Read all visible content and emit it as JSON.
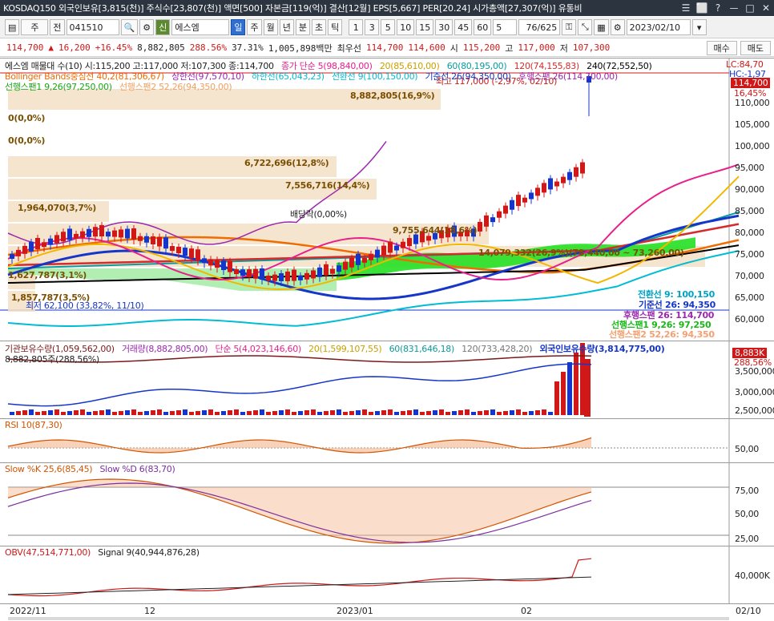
{
  "window": {
    "title": "KOSDAQ150 외국인보유[3,815(천)] 주식수[23,807(천)] 액면[500] 자본금[119(억)] 결산[12월] EPS[5,667] PER[20.24] 시가총액[27,307(억)] 유통비",
    "buttons": [
      "☰",
      "⬜",
      "?",
      "ㅡ",
      "□",
      "✕"
    ]
  },
  "toolbar": {
    "menu_icon": "▤",
    "market": "주",
    "all_label": "전",
    "code": "041510",
    "search_icon": "🔍",
    "new_badge": "신",
    "stock_name": "에스엠",
    "periods": [
      "일",
      "주",
      "월",
      "년",
      "분",
      "초",
      "틱"
    ],
    "intervals": [
      "1",
      "3",
      "5",
      "10",
      "15",
      "30",
      "45",
      "60",
      "5"
    ],
    "page_counter": "76/625",
    "date": "2023/02/10"
  },
  "quote": {
    "price": "114,700",
    "arrow": "▲",
    "change": "16,200",
    "change_pct": "+16.45%",
    "volume": "8,882,805",
    "volume_ratio": "288.56%",
    "turnover": "37.31%",
    "amount": "1,005,898백만",
    "best_label": "최우선",
    "best_price": "114,700",
    "ask": "114,600",
    "open_label": "시",
    "open": "115,200",
    "high_label": "고",
    "high": "117,000",
    "low_label": "저",
    "low": "107,300",
    "buy_label": "매수",
    "sell_label": "매도"
  },
  "price_panel": {
    "legend1": "에스엠 매물대 수(10)  시:115,200 고:117,000 저:107,300 종:114,700",
    "legend1_ma": [
      "종가 단순 5(98,840,00)",
      "20(85,610,00)",
      "60(80,195,00)",
      "120(74,155,83)",
      "240(72,552,50)"
    ],
    "legend2": [
      "Bollinger Bands중심선 40,2(81,306,67)",
      "상한선(97,570,10)",
      "하한선(65,043,23)",
      "전환선 9(100,150,00)",
      "기준선 26(94,350,00)",
      "후행스팬 26(114,700,00)"
    ],
    "legend3": [
      "선행스팬1 9,26(97,250,00)",
      "선행스팬2 52,26(94,350,00)"
    ],
    "right_lc": "LC:84,70",
    "right_hc": "HC:-1,97",
    "price_box": "114,700",
    "price_pct": "16,45%",
    "y_labels": [
      "110,000",
      "105,000",
      "100,000",
      "95,000",
      "90,000",
      "85,000",
      "80,000",
      "75,000",
      "70,000",
      "65,000",
      "60,000"
    ],
    "volume_profile_labels": [
      "8,882,805(16,9%)",
      "0(0,0%)",
      "0(0,0%)",
      "6,722,696(12,8%)",
      "7,556,716(14,4%)",
      "1,964,070(3,7%)",
      "9,755,644(18,6%)",
      "14,079,332(26,9%)(78,440,00 ~ 73,260,00)",
      "1,627,787(3,1%)",
      "1,857,787(3,5%)"
    ],
    "high_note": "최고 117,000 (-2,97%, 02/10)",
    "low_note": "최저 62,100 (33,82%, 11/10)",
    "dividend_note": "배당락(0,00%)",
    "right_values": [
      "전환선 9: 100,150",
      "기준선 26: 94,350",
      "후행스팬 26: 114,700",
      "선행스팬1 9,26: 97,250",
      "선행스팬2 52,26: 94,350"
    ]
  },
  "volume_panel": {
    "legend": [
      "기관보유수량(1,059,562,00)",
      "거래량(8,882,805,00)",
      "단순 5(4,023,146,60)",
      "20(1,599,107,55)",
      "60(831,646,18)",
      "120(733,428,20)",
      "외국인보유수량(3,814,775,00)"
    ],
    "legend2": "8,882,805주(288,56%)",
    "right_box": "8,883K",
    "right_pct": "288,56%",
    "y_labels": [
      "3,500,000",
      "3,000,000",
      "2,500,000"
    ]
  },
  "rsi_panel": {
    "legend": "RSI 10(87,30)",
    "y_labels": [
      "50,00"
    ]
  },
  "stoch_panel": {
    "legend": [
      "Slow %K 25,6(85,45)",
      "Slow %D 6(83,70)"
    ],
    "y_labels": [
      "75,00",
      "50,00",
      "25,00"
    ]
  },
  "obv_panel": {
    "legend": [
      "OBV(47,514,771,00)",
      "Signal 9(40,944,876,28)"
    ],
    "y_labels": [
      "40,000K"
    ]
  },
  "date_axis": [
    "2022/11",
    "12",
    "2023/01",
    "02",
    "02/10"
  ],
  "colors": {
    "up": "#d01818",
    "down": "#1536c9",
    "titlebar": "#2c3440",
    "ma5": "#e8208c",
    "ma20": "#f2b800",
    "ma60": "#0a9b9b",
    "ma120": "#d62b2b",
    "ma240": "#000000",
    "bb_mid": "#ef6c00",
    "bb_up": "#9c27b0",
    "bb_low": "#00bcd4",
    "cloud": "#23e023",
    "profile": "#f5e0c5"
  }
}
